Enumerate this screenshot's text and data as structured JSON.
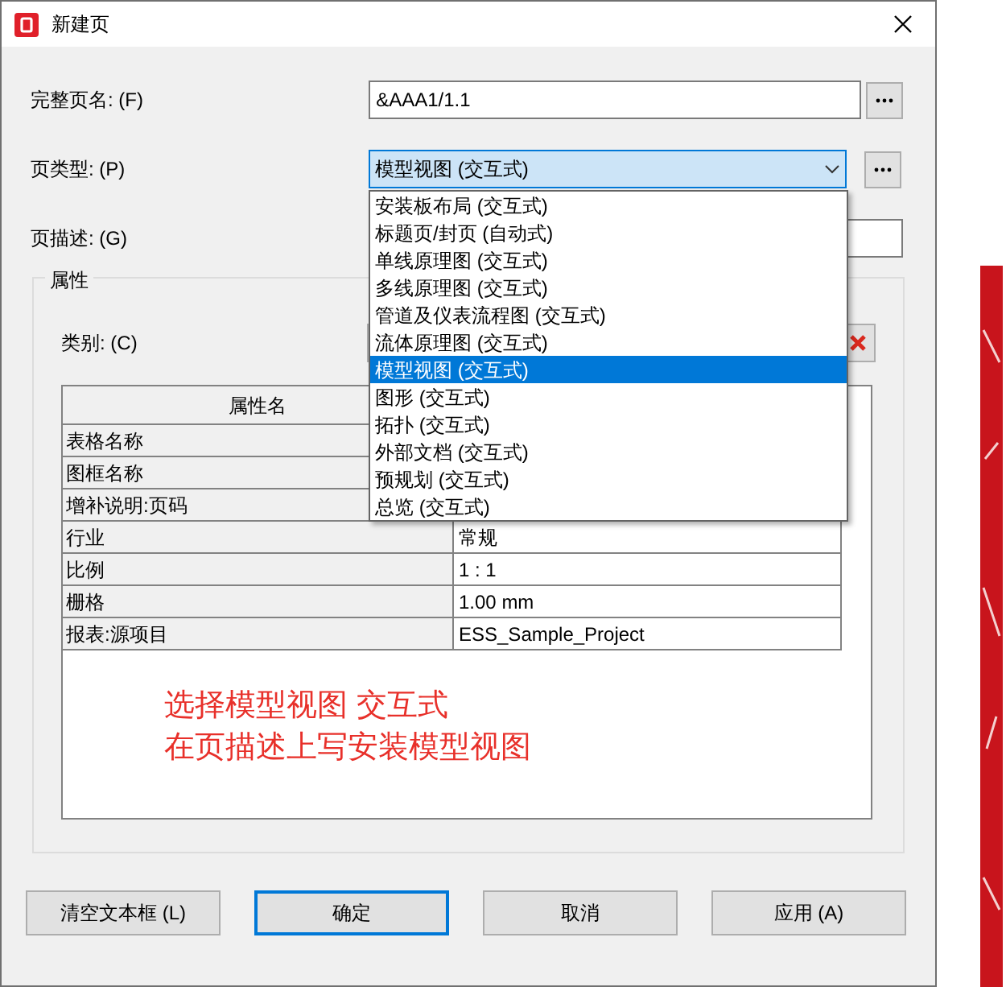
{
  "window": {
    "title": "新建页"
  },
  "fields": [
    {
      "label": "完整页名: (F)",
      "value": "&AAA1/1.1",
      "kind": "text",
      "browse": true
    },
    {
      "label": "页类型: (P)",
      "value": "模型视图 (交互式)",
      "kind": "select",
      "browse": true
    },
    {
      "label": "页描述: (G)",
      "kind": "text",
      "browse": false
    }
  ],
  "dropdown": [
    {
      "label": "安装板布局 (交互式)",
      "selected": false
    },
    {
      "label": "标题页/封页 (自动式)",
      "selected": false
    },
    {
      "label": "单线原理图 (交互式)",
      "selected": false
    },
    {
      "label": "多线原理图 (交互式)",
      "selected": false
    },
    {
      "label": "管道及仪表流程图 (交互式)",
      "selected": false
    },
    {
      "label": "流体原理图 (交互式)",
      "selected": false
    },
    {
      "label": "模型视图 (交互式)",
      "selected": true
    },
    {
      "label": "图形 (交互式)",
      "selected": false
    },
    {
      "label": "拓扑 (交互式)",
      "selected": false
    },
    {
      "label": "外部文档 (交互式)",
      "selected": false
    },
    {
      "label": "预规划 (交互式)",
      "selected": false
    },
    {
      "label": "总览 (交互式)",
      "selected": false
    }
  ],
  "properties": {
    "title": "属性",
    "category_label": "类别: (C)",
    "columns": [
      "属性名"
    ],
    "rows": [
      {
        "name": "表格名称"
      },
      {
        "name": "图框名称"
      },
      {
        "name": "增补说明:页码"
      },
      {
        "name": "行业",
        "value": "常规"
      },
      {
        "name": "比例",
        "value": "1 : 1"
      },
      {
        "name": "栅格",
        "value": "1.00 mm"
      },
      {
        "name": "报表:源项目",
        "value": "ESS_Sample_Project"
      }
    ],
    "annotation": [
      "选择模型视图 交互式",
      "在页描述上写安装模型视图"
    ]
  },
  "buttons": [
    {
      "label": "清空文本框 (L)",
      "selected": false
    },
    {
      "label": "确定",
      "selected": true
    },
    {
      "label": "取消",
      "selected": false
    },
    {
      "label": "应用 (A)",
      "selected": false
    }
  ]
}
